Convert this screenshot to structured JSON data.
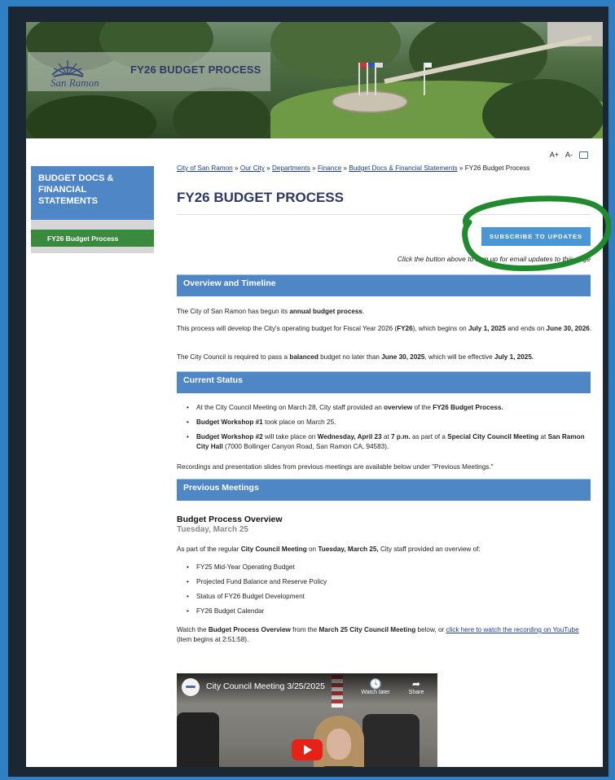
{
  "banner": {
    "logo_text": "San Ramon",
    "title": "FY26 BUDGET PROCESS"
  },
  "tools": {
    "increase": "A+",
    "decrease": "A-",
    "print_icon": "printer-icon"
  },
  "sidebar": {
    "heading": "BUDGET DOCS & FINANCIAL STATEMENTS",
    "items": [
      {
        "label": "FY26 Budget Process",
        "active": true
      }
    ]
  },
  "breadcrumb": {
    "links": [
      "City of San Ramon",
      "Our City",
      "Departments",
      "Finance",
      "Budget Docs & Financial Statements"
    ],
    "separator": "»",
    "current": "FY26 Budget Process"
  },
  "page": {
    "title": "FY26 BUDGET PROCESS",
    "subscribe_button": "SUBSCRIBE TO UPDATES",
    "subscribe_note": "Click the button above to sign up for email updates to this page"
  },
  "overview": {
    "heading": "Overview and Timeline",
    "p1_pre": "The City of San Ramon has begun its ",
    "p1_bold": "annual budget process",
    "p1_post": ".",
    "p2_a": "This process will develop the City's operating budget for Fiscal Year 2026 (",
    "p2_b": "FY26",
    "p2_c": "), which begins on ",
    "p2_d": "July 1, 2025",
    "p2_e": " and ends on ",
    "p2_f": "June 30, 2026",
    "p2_g": ".",
    "p3_a": "The City Council is required to pass a ",
    "p3_b": "balanced",
    "p3_c": " budget no later than ",
    "p3_d": "June 30, 2025",
    "p3_e": ", which will be effective ",
    "p3_f": "July 1, 2025."
  },
  "status": {
    "heading": "Current Status",
    "b1_a": "At the City Council Meeting on March 28, City staff provided an ",
    "b1_b": "overview",
    "b1_c": " of the ",
    "b1_d": "FY26 Budget Process.",
    "b2_a": "Budget Workshop #1",
    "b2_b": " took place on March 25.",
    "b3_a": "Budget Workshop #2",
    "b3_b": " will take place on ",
    "b3_c": "Wednesday, April 23",
    "b3_d": " at ",
    "b3_e": "7 p.m.",
    "b3_f": " as part of a ",
    "b3_g": "Special City Council Meeting",
    "b3_h": " at ",
    "b3_i": "San Ramon City Hall",
    "b3_j": " (7000 Bollinger Canyon Road, San Ramon CA, 94583).",
    "note": "Recordings and presentation slides from previous meetings are available below under \"Previous Meetings.\""
  },
  "previous": {
    "heading": "Previous Meetings",
    "item_title": "Budget Process Overview",
    "item_date": "Tuesday, March 25",
    "intro_a": "As part of the regular ",
    "intro_b": "City Council Meeting",
    "intro_c": " on ",
    "intro_d": "Tuesday, March 25,",
    "intro_e": " City staff provided an overview of:",
    "list": [
      "FY25 Mid-Year Operating Budget",
      "Projected Fund Balance and Reserve Policy",
      "Status of FY26 Budget Development",
      "FY26 Budget Calendar"
    ],
    "watch_a": "Watch the ",
    "watch_b": "Budget Process Overview",
    "watch_c": " from the ",
    "watch_d": "March 25 City Council Meeting",
    "watch_e": " below, or ",
    "watch_link": "click here to watch the recording on YouTube",
    "watch_f": " (item begins at 2:51:58)."
  },
  "video": {
    "title": "City Council Meeting 3/25/2025",
    "watch_later": "Watch later",
    "share": "Share"
  },
  "colors": {
    "section_blue": "#4f86c6",
    "active_green": "#3a8a3d",
    "subscribe_blue": "#4b97d6",
    "annotation_green": "#1f8a2e",
    "title_navy": "#2c3a66"
  }
}
